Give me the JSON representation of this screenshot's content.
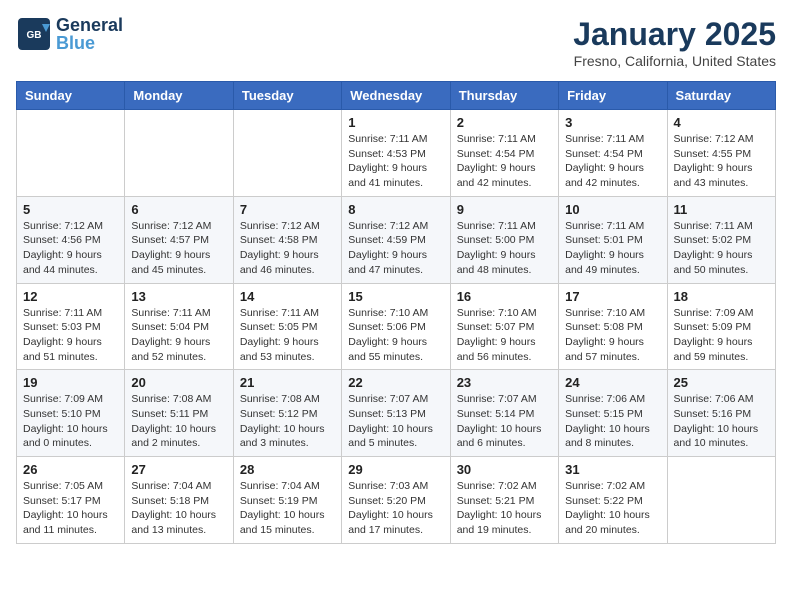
{
  "header": {
    "logo_line1": "General",
    "logo_line2": "Blue",
    "month": "January 2025",
    "location": "Fresno, California, United States"
  },
  "weekdays": [
    "Sunday",
    "Monday",
    "Tuesday",
    "Wednesday",
    "Thursday",
    "Friday",
    "Saturday"
  ],
  "weeks": [
    [
      {
        "day": "",
        "info": ""
      },
      {
        "day": "",
        "info": ""
      },
      {
        "day": "",
        "info": ""
      },
      {
        "day": "1",
        "info": "Sunrise: 7:11 AM\nSunset: 4:53 PM\nDaylight: 9 hours\nand 41 minutes."
      },
      {
        "day": "2",
        "info": "Sunrise: 7:11 AM\nSunset: 4:54 PM\nDaylight: 9 hours\nand 42 minutes."
      },
      {
        "day": "3",
        "info": "Sunrise: 7:11 AM\nSunset: 4:54 PM\nDaylight: 9 hours\nand 42 minutes."
      },
      {
        "day": "4",
        "info": "Sunrise: 7:12 AM\nSunset: 4:55 PM\nDaylight: 9 hours\nand 43 minutes."
      }
    ],
    [
      {
        "day": "5",
        "info": "Sunrise: 7:12 AM\nSunset: 4:56 PM\nDaylight: 9 hours\nand 44 minutes."
      },
      {
        "day": "6",
        "info": "Sunrise: 7:12 AM\nSunset: 4:57 PM\nDaylight: 9 hours\nand 45 minutes."
      },
      {
        "day": "7",
        "info": "Sunrise: 7:12 AM\nSunset: 4:58 PM\nDaylight: 9 hours\nand 46 minutes."
      },
      {
        "day": "8",
        "info": "Sunrise: 7:12 AM\nSunset: 4:59 PM\nDaylight: 9 hours\nand 47 minutes."
      },
      {
        "day": "9",
        "info": "Sunrise: 7:11 AM\nSunset: 5:00 PM\nDaylight: 9 hours\nand 48 minutes."
      },
      {
        "day": "10",
        "info": "Sunrise: 7:11 AM\nSunset: 5:01 PM\nDaylight: 9 hours\nand 49 minutes."
      },
      {
        "day": "11",
        "info": "Sunrise: 7:11 AM\nSunset: 5:02 PM\nDaylight: 9 hours\nand 50 minutes."
      }
    ],
    [
      {
        "day": "12",
        "info": "Sunrise: 7:11 AM\nSunset: 5:03 PM\nDaylight: 9 hours\nand 51 minutes."
      },
      {
        "day": "13",
        "info": "Sunrise: 7:11 AM\nSunset: 5:04 PM\nDaylight: 9 hours\nand 52 minutes."
      },
      {
        "day": "14",
        "info": "Sunrise: 7:11 AM\nSunset: 5:05 PM\nDaylight: 9 hours\nand 53 minutes."
      },
      {
        "day": "15",
        "info": "Sunrise: 7:10 AM\nSunset: 5:06 PM\nDaylight: 9 hours\nand 55 minutes."
      },
      {
        "day": "16",
        "info": "Sunrise: 7:10 AM\nSunset: 5:07 PM\nDaylight: 9 hours\nand 56 minutes."
      },
      {
        "day": "17",
        "info": "Sunrise: 7:10 AM\nSunset: 5:08 PM\nDaylight: 9 hours\nand 57 minutes."
      },
      {
        "day": "18",
        "info": "Sunrise: 7:09 AM\nSunset: 5:09 PM\nDaylight: 9 hours\nand 59 minutes."
      }
    ],
    [
      {
        "day": "19",
        "info": "Sunrise: 7:09 AM\nSunset: 5:10 PM\nDaylight: 10 hours\nand 0 minutes."
      },
      {
        "day": "20",
        "info": "Sunrise: 7:08 AM\nSunset: 5:11 PM\nDaylight: 10 hours\nand 2 minutes."
      },
      {
        "day": "21",
        "info": "Sunrise: 7:08 AM\nSunset: 5:12 PM\nDaylight: 10 hours\nand 3 minutes."
      },
      {
        "day": "22",
        "info": "Sunrise: 7:07 AM\nSunset: 5:13 PM\nDaylight: 10 hours\nand 5 minutes."
      },
      {
        "day": "23",
        "info": "Sunrise: 7:07 AM\nSunset: 5:14 PM\nDaylight: 10 hours\nand 6 minutes."
      },
      {
        "day": "24",
        "info": "Sunrise: 7:06 AM\nSunset: 5:15 PM\nDaylight: 10 hours\nand 8 minutes."
      },
      {
        "day": "25",
        "info": "Sunrise: 7:06 AM\nSunset: 5:16 PM\nDaylight: 10 hours\nand 10 minutes."
      }
    ],
    [
      {
        "day": "26",
        "info": "Sunrise: 7:05 AM\nSunset: 5:17 PM\nDaylight: 10 hours\nand 11 minutes."
      },
      {
        "day": "27",
        "info": "Sunrise: 7:04 AM\nSunset: 5:18 PM\nDaylight: 10 hours\nand 13 minutes."
      },
      {
        "day": "28",
        "info": "Sunrise: 7:04 AM\nSunset: 5:19 PM\nDaylight: 10 hours\nand 15 minutes."
      },
      {
        "day": "29",
        "info": "Sunrise: 7:03 AM\nSunset: 5:20 PM\nDaylight: 10 hours\nand 17 minutes."
      },
      {
        "day": "30",
        "info": "Sunrise: 7:02 AM\nSunset: 5:21 PM\nDaylight: 10 hours\nand 19 minutes."
      },
      {
        "day": "31",
        "info": "Sunrise: 7:02 AM\nSunset: 5:22 PM\nDaylight: 10 hours\nand 20 minutes."
      },
      {
        "day": "",
        "info": ""
      }
    ]
  ]
}
